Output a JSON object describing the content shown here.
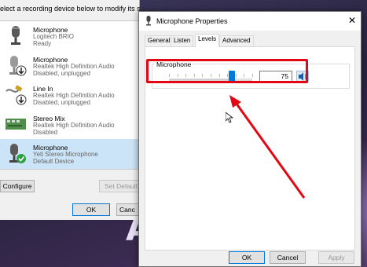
{
  "back_window": {
    "instruction": "elect a recording device below to modify its settings:",
    "devices": [
      {
        "name": "Microphone",
        "line1": "Logitech BRIO",
        "line2": "Ready"
      },
      {
        "name": "Microphone",
        "line1": "Realtek High Definition Audio",
        "line2": "Disabled, unplugged"
      },
      {
        "name": "Line In",
        "line1": "Realtek High Definition Audio",
        "line2": "Disabled, unplugged"
      },
      {
        "name": "Stereo Mix",
        "line1": "Realtek High Definition Audio",
        "line2": "Disabled"
      },
      {
        "name": "Microphone",
        "line1": "Yeti Stereo Microphone",
        "line2": "Default Device"
      }
    ],
    "configure_label": "Configure",
    "set_default_label": "Set Default",
    "ok_label": "OK",
    "cancel_label": "Canc"
  },
  "props_window": {
    "title": "Microphone Properties",
    "close_glyph": "✕",
    "tabs": [
      "General",
      "Listen",
      "Levels",
      "Advanced"
    ],
    "active_tab": "Levels",
    "group_label": "Microphone",
    "level_value": "75",
    "slider_fraction": 0.75,
    "ok_label": "OK",
    "cancel_label": "Cancel",
    "apply_label": "Apply"
  },
  "wallpaper": {
    "letter": "A"
  },
  "colors": {
    "accent": "#0078d7",
    "annotation": "#e30613",
    "selection": "#cce4f7"
  },
  "icons": [
    "microphone-icon",
    "line-in-icon",
    "stereo-mix-icon",
    "speaker-icon",
    "close-icon",
    "check-icon",
    "down-arrow-icon",
    "mouse-cursor-icon"
  ]
}
